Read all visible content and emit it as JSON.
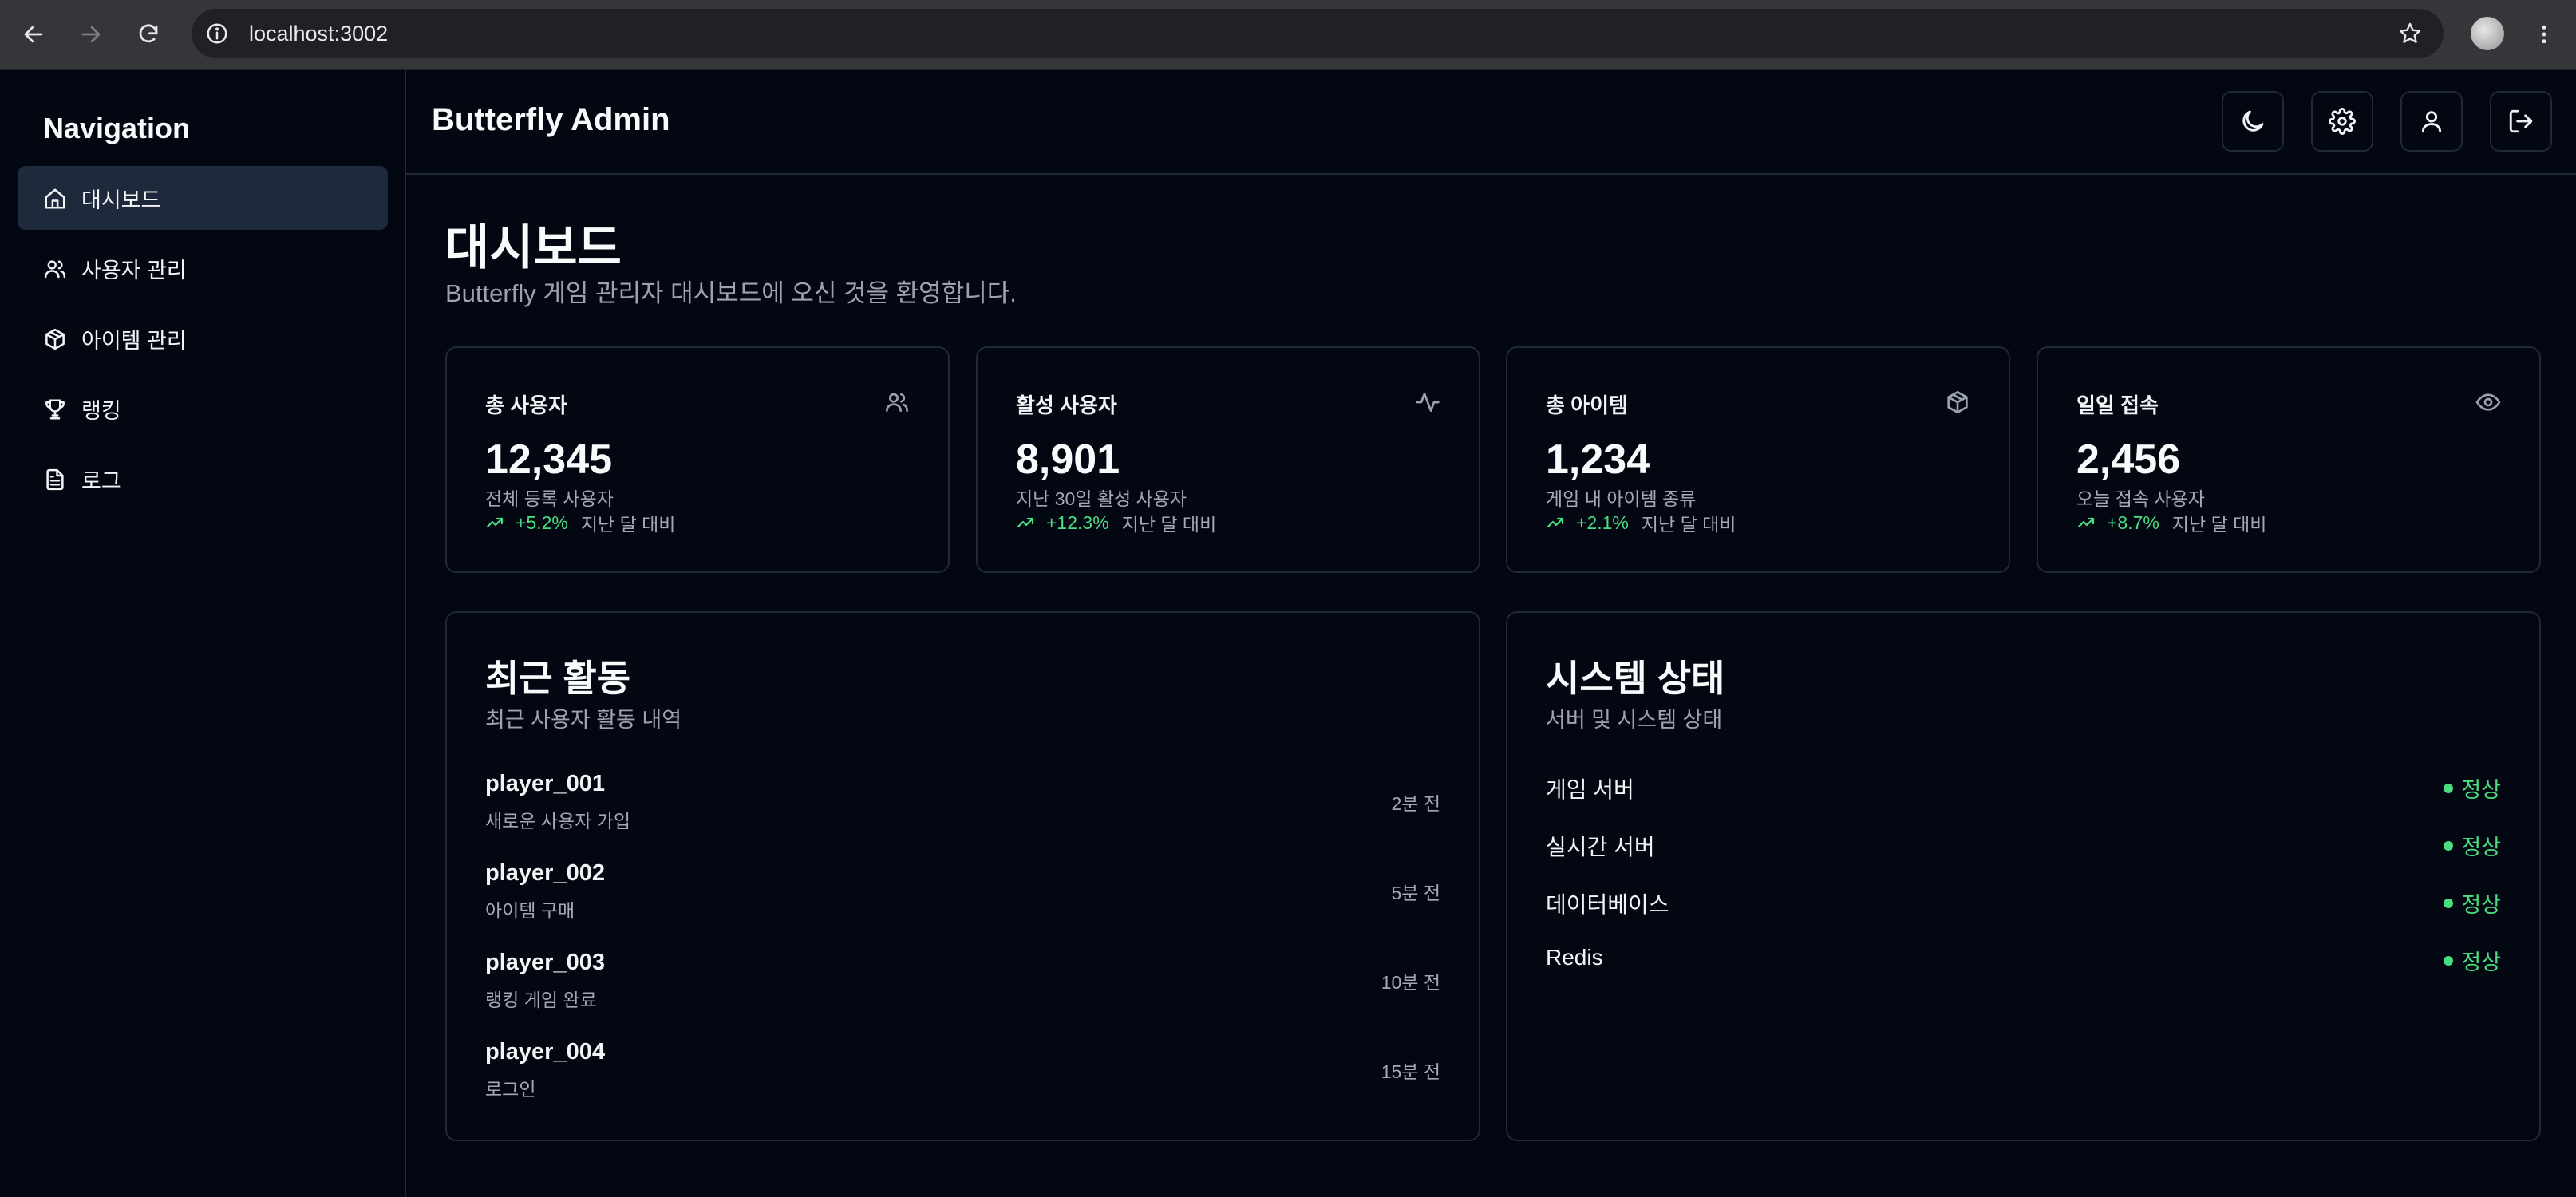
{
  "browser": {
    "url": "localhost:3002",
    "icons": [
      "back-icon",
      "forward-icon",
      "reload-icon",
      "info-icon",
      "star-icon",
      "more-vert-icon"
    ]
  },
  "sidebar": {
    "title": "Navigation",
    "items": [
      {
        "label": "대시보드",
        "icon": "home-icon",
        "active": true
      },
      {
        "label": "사용자 관리",
        "icon": "users-icon",
        "active": false
      },
      {
        "label": "아이템 관리",
        "icon": "package-icon",
        "active": false
      },
      {
        "label": "랭킹",
        "icon": "trophy-icon",
        "active": false
      },
      {
        "label": "로그",
        "icon": "file-text-icon",
        "active": false
      }
    ]
  },
  "header": {
    "title": "Butterfly Admin",
    "buttons": [
      "moon-icon",
      "settings-icon",
      "user-icon",
      "logout-icon"
    ]
  },
  "page": {
    "title": "대시보드",
    "subtitle": "Butterfly 게임 관리자 대시보드에 오신 것을 환영합니다."
  },
  "stats": [
    {
      "title": "총 사용자",
      "icon": "users-icon",
      "value": "12,345",
      "desc": "전체 등록 사용자",
      "trend": "+5.2%",
      "note": "지난 달 대비"
    },
    {
      "title": "활성 사용자",
      "icon": "activity-icon",
      "value": "8,901",
      "desc": "지난 30일 활성 사용자",
      "trend": "+12.3%",
      "note": "지난 달 대비"
    },
    {
      "title": "총 아이템",
      "icon": "package-icon",
      "value": "1,234",
      "desc": "게임 내 아이템 종류",
      "trend": "+2.1%",
      "note": "지난 달 대비"
    },
    {
      "title": "일일 접속",
      "icon": "eye-icon",
      "value": "2,456",
      "desc": "오늘 접속 사용자",
      "trend": "+8.7%",
      "note": "지난 달 대비"
    }
  ],
  "activity": {
    "title": "최근 활동",
    "subtitle": "최근 사용자 활동 내역",
    "items": [
      {
        "user": "player_001",
        "action": "새로운 사용자 가입",
        "time": "2분 전"
      },
      {
        "user": "player_002",
        "action": "아이템 구매",
        "time": "5분 전"
      },
      {
        "user": "player_003",
        "action": "랭킹 게임 완료",
        "time": "10분 전"
      },
      {
        "user": "player_004",
        "action": "로그인",
        "time": "15분 전"
      }
    ]
  },
  "system": {
    "title": "시스템 상태",
    "subtitle": "서버 및 시스템 상태",
    "items": [
      {
        "name": "게임 서버",
        "status": "정상"
      },
      {
        "name": "실시간 서버",
        "status": "정상"
      },
      {
        "name": "데이터베이스",
        "status": "정상"
      },
      {
        "name": "Redis",
        "status": "정상"
      }
    ]
  },
  "colors": {
    "background": "#030712",
    "border": "#1f2937",
    "active_nav": "#1e293b",
    "positive": "#4ade80",
    "muted_text": "#9ca3af"
  }
}
